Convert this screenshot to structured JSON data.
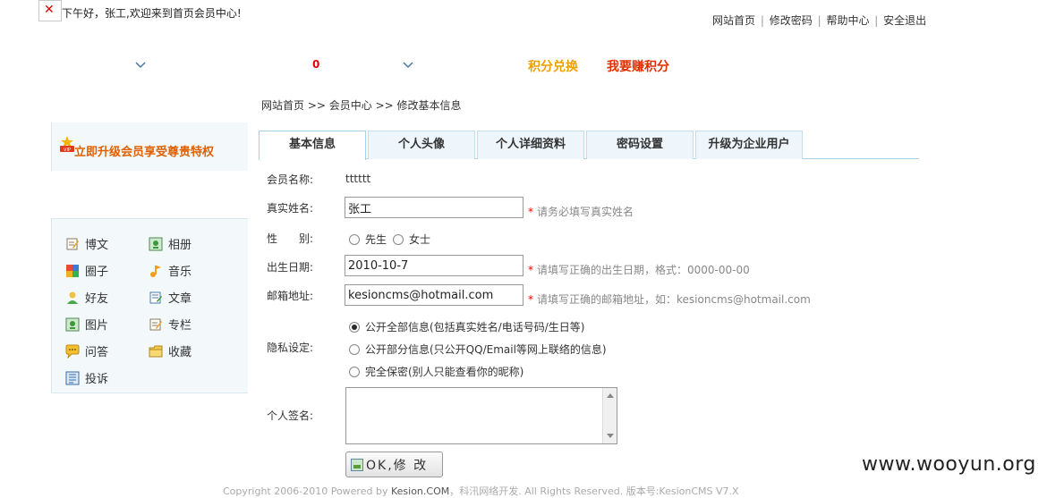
{
  "header": {
    "broken_image_icon": "broken-image-icon",
    "greeting": "下午好，张工,欢迎来到首页会员中心!",
    "nav": [
      {
        "label": "网站首页"
      },
      {
        "label": "修改密码"
      },
      {
        "label": "帮助中心"
      },
      {
        "label": "安全退出"
      }
    ],
    "nav_separator": "|"
  },
  "points_bar": {
    "count": "0",
    "redeem_label": "积分兑换",
    "earn_label": "我要赚积分"
  },
  "breadcrumb": {
    "home": "网站首页",
    "member_center": ">> 会员中心",
    "current": ">> 修改基本信息"
  },
  "sidebar": {
    "vip_upgrade": "立即升级会员享受尊贵特权",
    "items": [
      {
        "label": "博文",
        "icon": "blog-icon"
      },
      {
        "label": "相册",
        "icon": "album-icon"
      },
      {
        "label": "圈子",
        "icon": "group-icon"
      },
      {
        "label": "音乐",
        "icon": "music-icon"
      },
      {
        "label": "好友",
        "icon": "friend-icon"
      },
      {
        "label": "文章",
        "icon": "article-icon"
      },
      {
        "label": "图片",
        "icon": "picture-icon"
      },
      {
        "label": "专栏",
        "icon": "column-icon"
      },
      {
        "label": "问答",
        "icon": "qa-icon"
      },
      {
        "label": "收藏",
        "icon": "favorite-icon"
      },
      {
        "label": "投诉",
        "icon": "complaint-icon"
      }
    ]
  },
  "tabs": [
    {
      "label": "基本信息",
      "active": true
    },
    {
      "label": "个人头像"
    },
    {
      "label": "个人详细资料"
    },
    {
      "label": "密码设置"
    },
    {
      "label": "升级为企业用户"
    }
  ],
  "form": {
    "member_name_label": "会员名称:",
    "member_name_value": "tttttt",
    "real_name_label": "真实姓名:",
    "real_name_value": "张工",
    "real_name_hint": "请务必填写真实姓名",
    "gender_label": "性　　别:",
    "gender_options": [
      "先生",
      "女士"
    ],
    "birth_label": "出生日期:",
    "birth_value": "2010-10-7",
    "birth_hint": "请填写正确的出生日期，格式：0000-00-00",
    "email_label": "邮箱地址:",
    "email_value": "kesioncms@hotmail.com",
    "email_hint": "请填写正确的邮箱地址，如：kesioncms@hotmail.com",
    "required_mark": "*",
    "privacy_label": "隐私设定:",
    "privacy_options": [
      {
        "label": "公开全部信息(包括真实姓名/电话号码/生日等)",
        "selected": true
      },
      {
        "label": "公开部分信息(只公开QQ/Email等网上联络的信息)"
      },
      {
        "label": "完全保密(别人只能查看你的昵称)"
      }
    ],
    "signature_label": "个人签名:",
    "submit_label": "OK,修 改"
  },
  "footer": {
    "copyright": "Copyright 2006-2010 Powered by",
    "brand": "Kesion.COM",
    "rest": "，科汛网络开发. All Rights Reserved. 版本号:KesionCMS V7.X"
  },
  "watermark": "www.wooyun.org"
}
